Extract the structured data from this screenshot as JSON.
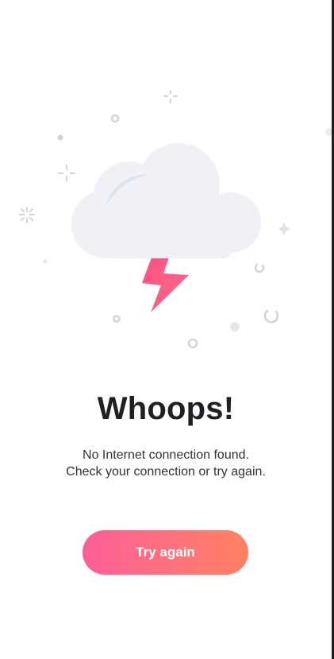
{
  "error": {
    "title": "Whoops!",
    "message_line1": "No Internet connection found.",
    "message_line2": "Check your connection or try again."
  },
  "actions": {
    "retry_label": "Try again"
  },
  "illustration": {
    "cloud_icon": "cloud-icon",
    "lightning_icon": "lightning-bolt-icon",
    "cloud_color": "#f0f1f7",
    "bolt_color": "#fc5c86",
    "particle_color": "#d3d8e2"
  },
  "colors": {
    "button_gradient_start": "#fd5f98",
    "button_gradient_end": "#ff8262",
    "title_color": "#1f1f24",
    "text_color": "#33333a"
  }
}
